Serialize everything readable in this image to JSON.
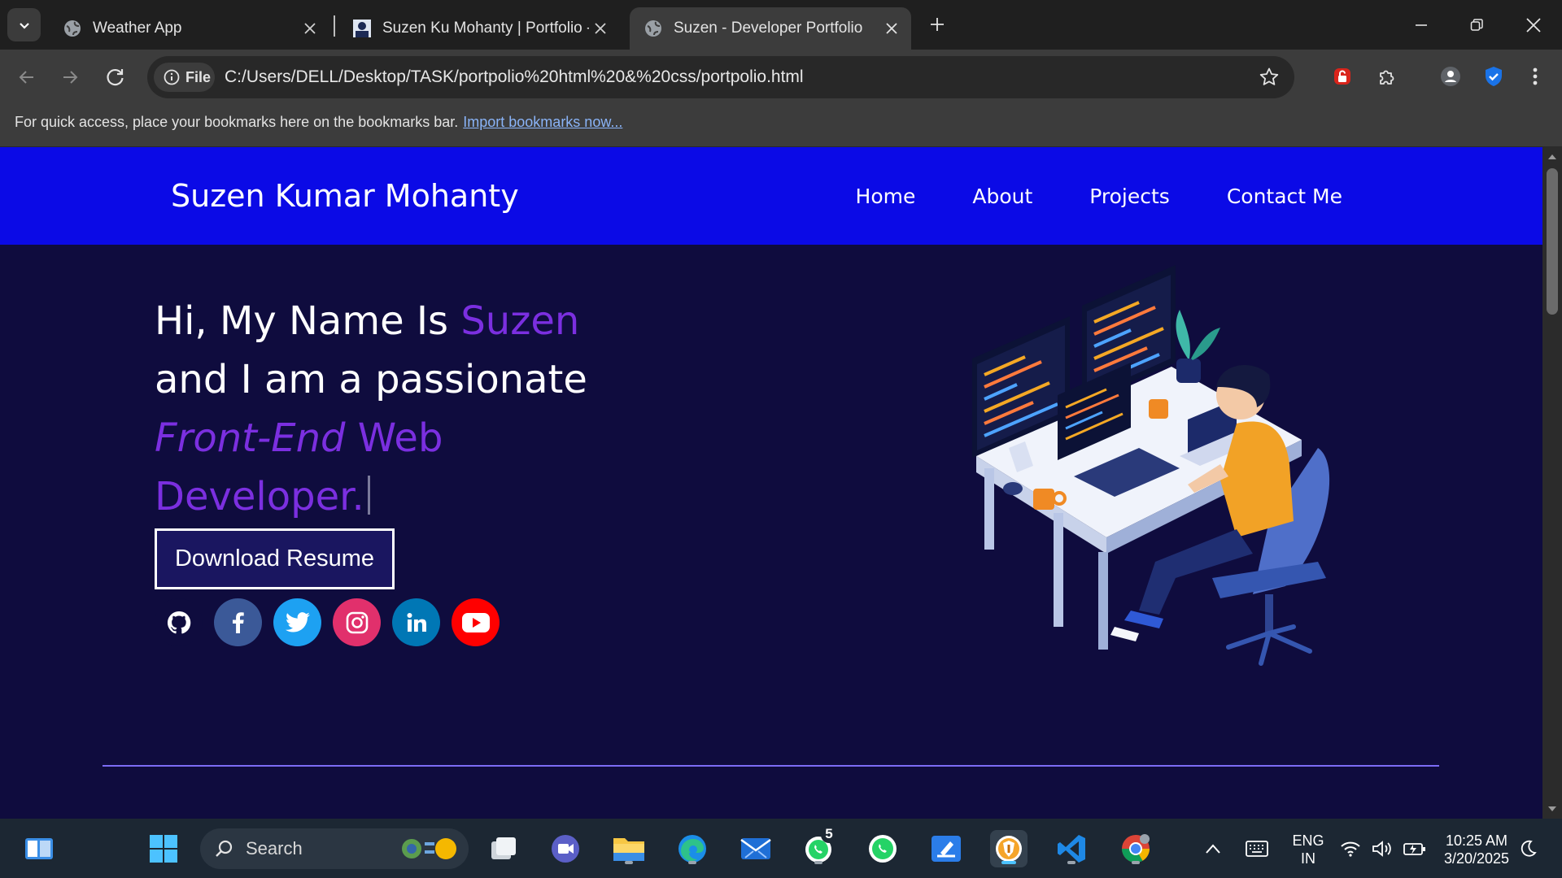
{
  "browser": {
    "tabs": [
      {
        "title": "Weather App",
        "favicon": "globe-icon"
      },
      {
        "title": "Suzen Ku Mohanty | Portfolio - ",
        "favicon": "avatar-icon"
      },
      {
        "title": "Suzen - Developer Portfolio",
        "favicon": "globe-icon",
        "active": true
      }
    ],
    "site_info_label": "File",
    "url": "C:/Users/DELL/Desktop/TASK/portpolio%20html%20&%20css/portpolio.html",
    "bookmarks_message": "For quick access, place your bookmarks here on the bookmarks bar.",
    "bookmarks_link": "Import bookmarks now..."
  },
  "site": {
    "brand": "Suzen Kumar Mohanty",
    "nav": [
      "Home",
      "About",
      "Projects",
      "Contact Me"
    ],
    "hero": {
      "line1_plain": "Hi, My Name Is ",
      "line1_accent": "Suzen",
      "line2": "and I am a passionate",
      "line3_italic": "Front-End",
      "line3_rest": " Web",
      "line4": "Developer."
    },
    "resume_button": "Download Resume",
    "socials": [
      {
        "name": "github-icon",
        "color": "#0f0c3e"
      },
      {
        "name": "facebook-icon",
        "color": "#3b5998"
      },
      {
        "name": "twitter-icon",
        "color": "#1da1f2"
      },
      {
        "name": "instagram-icon",
        "color": "#e1306c"
      },
      {
        "name": "linkedin-icon",
        "color": "#0077b5"
      },
      {
        "name": "youtube-icon",
        "color": "#ff0000"
      }
    ],
    "colors": {
      "nav_bg": "#0b0ae6",
      "page_bg": "#0f0c3e",
      "accent": "#7b2fe0"
    }
  },
  "taskbar": {
    "search_placeholder": "Search",
    "whatsapp_badge": "5",
    "language_line1": "ENG",
    "language_line2": "IN",
    "time": "10:25 AM",
    "date": "3/20/2025"
  }
}
